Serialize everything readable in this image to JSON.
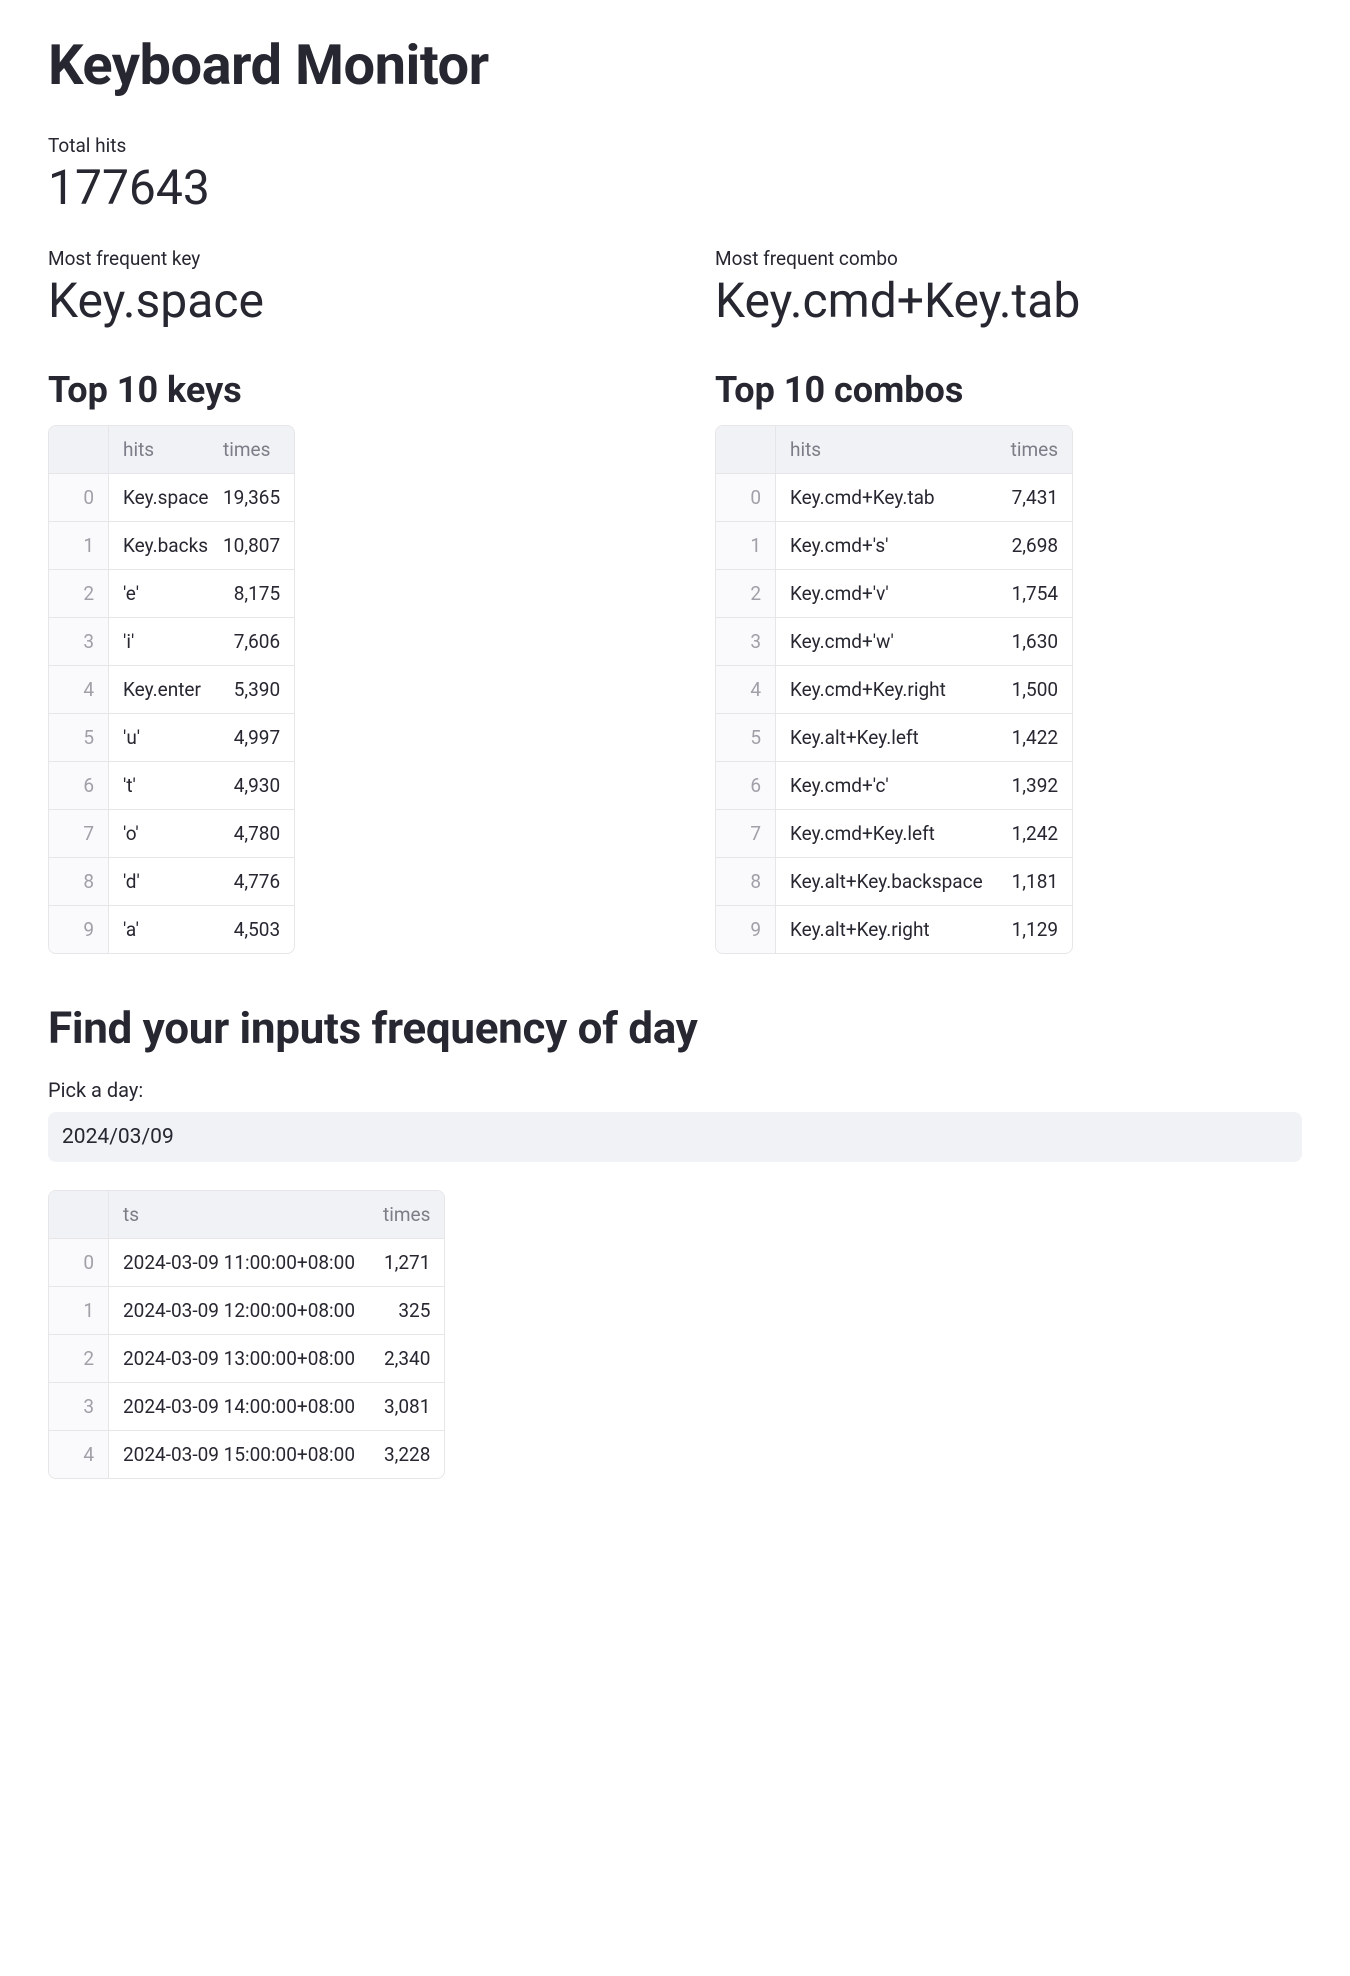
{
  "page_title": "Keyboard Monitor",
  "total": {
    "label": "Total hits",
    "value": "177643"
  },
  "most_key": {
    "label": "Most frequent key",
    "value": "Key.space"
  },
  "most_combo": {
    "label": "Most frequent combo",
    "value": "Key.cmd+Key.tab"
  },
  "top_keys": {
    "title": "Top 10 keys",
    "headers": {
      "hits": "hits",
      "times": "times"
    },
    "rows": [
      {
        "idx": "0",
        "hits": "Key.space",
        "times": "19,365"
      },
      {
        "idx": "1",
        "hits": "Key.backsp",
        "times": "10,807"
      },
      {
        "idx": "2",
        "hits": "'e'",
        "times": "8,175"
      },
      {
        "idx": "3",
        "hits": "'i'",
        "times": "7,606"
      },
      {
        "idx": "4",
        "hits": "Key.enter",
        "times": "5,390"
      },
      {
        "idx": "5",
        "hits": "'u'",
        "times": "4,997"
      },
      {
        "idx": "6",
        "hits": "'t'",
        "times": "4,930"
      },
      {
        "idx": "7",
        "hits": "'o'",
        "times": "4,780"
      },
      {
        "idx": "8",
        "hits": "'d'",
        "times": "4,776"
      },
      {
        "idx": "9",
        "hits": "'a'",
        "times": "4,503"
      }
    ]
  },
  "top_combos": {
    "title": "Top 10 combos",
    "headers": {
      "hits": "hits",
      "times": "times"
    },
    "rows": [
      {
        "idx": "0",
        "hits": "Key.cmd+Key.tab",
        "times": "7,431"
      },
      {
        "idx": "1",
        "hits": "Key.cmd+'s'",
        "times": "2,698"
      },
      {
        "idx": "2",
        "hits": "Key.cmd+'v'",
        "times": "1,754"
      },
      {
        "idx": "3",
        "hits": "Key.cmd+'w'",
        "times": "1,630"
      },
      {
        "idx": "4",
        "hits": "Key.cmd+Key.right",
        "times": "1,500"
      },
      {
        "idx": "5",
        "hits": "Key.alt+Key.left",
        "times": "1,422"
      },
      {
        "idx": "6",
        "hits": "Key.cmd+'c'",
        "times": "1,392"
      },
      {
        "idx": "7",
        "hits": "Key.cmd+Key.left",
        "times": "1,242"
      },
      {
        "idx": "8",
        "hits": "Key.alt+Key.backspace",
        "times": "1,181"
      },
      {
        "idx": "9",
        "hits": "Key.alt+Key.right",
        "times": "1,129"
      }
    ]
  },
  "freq": {
    "title": "Find your inputs frequency of day",
    "pick_label": "Pick a day:",
    "date_value": "2024/03/09",
    "headers": {
      "ts": "ts",
      "times": "times"
    },
    "rows": [
      {
        "idx": "0",
        "ts": "2024-03-09 11:00:00+08:00",
        "times": "1,271"
      },
      {
        "idx": "1",
        "ts": "2024-03-09 12:00:00+08:00",
        "times": "325"
      },
      {
        "idx": "2",
        "ts": "2024-03-09 13:00:00+08:00",
        "times": "2,340"
      },
      {
        "idx": "3",
        "ts": "2024-03-09 14:00:00+08:00",
        "times": "3,081"
      },
      {
        "idx": "4",
        "ts": "2024-03-09 15:00:00+08:00",
        "times": "3,228"
      }
    ]
  }
}
